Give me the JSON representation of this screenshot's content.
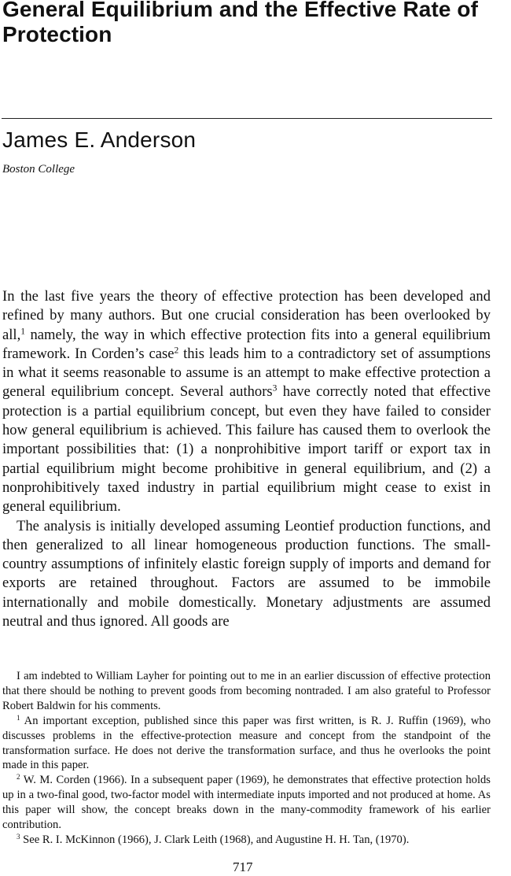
{
  "article": {
    "title": "General Equilibrium and the Effective Rate of Protection",
    "author": "James E. Anderson",
    "affiliation": "Boston College"
  },
  "body": {
    "p1": {
      "a": "In the last five years the theory of effective protection has been developed and refined by many authors. But one crucial consideration has been overlooked by all,",
      "a_ref": "1",
      "b": " namely, the way in which effective protection fits into a general equilibrium framework. In Corden’s case",
      "b_ref": "2",
      "c": " this leads him to a contradictory set of assumptions in what it seems reasonable to assume is an attempt to make effective protection a general equilibrium concept. Several authors",
      "c_ref": "3",
      "d": " have correctly noted that effective protection is a partial equilibrium concept, but even they have failed to consider how general equilibrium is achieved. This failure has caused them to overlook the important possibilities that: (1) a nonprohibitive import tariff or export tax in partial equilibrium might become prohibitive in general equilibrium, and (2) a nonprohibitively taxed industry in partial equilibrium might cease to exist in general equilibrium."
    },
    "p2": "The analysis is initially developed assuming Leontief production functions, and then generalized to all linear homogeneous production functions. The small-country assumptions of infinitely elastic foreign supply of imports and demand for exports are retained throughout. Factors are assumed to be immobile internationally and mobile domestically. Monetary adjustments are assumed neutral and thus ignored. All goods are"
  },
  "footnotes": {
    "ack": "I am indebted to William Layher for pointing out to me in an earlier discussion of effective protection that there should be nothing to prevent goods from becoming nontraded. I am also grateful to Professor Robert Baldwin for his comments.",
    "fn1_mark": "1",
    "fn1": " An important exception, published since this paper was first written, is R. J. Ruffin (1969), who discusses problems in the effective-protection measure and concept from the standpoint of the transformation surface. He does not derive the transformation surface, and thus he overlooks the point made in this paper.",
    "fn2_mark": "2",
    "fn2": " W. M. Corden (1966). In a subsequent paper (1969), he demonstrates that effective protection holds up in a two-final good, two-factor model with intermediate inputs imported and not produced at home. As this paper will show, the concept breaks down in the many-commodity framework of his earlier contribution.",
    "fn3_mark": "3",
    "fn3": " See R. I. McKinnon (1966), J. Clark Leith (1968), and Augustine H. H. Tan, (1970)."
  },
  "page_number": "717"
}
